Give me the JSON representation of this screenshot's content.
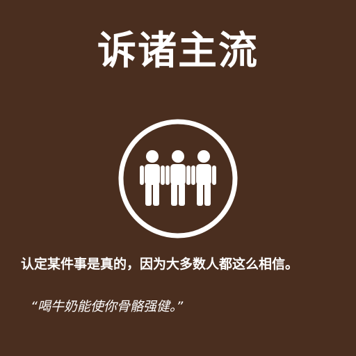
{
  "card": {
    "title": "诉诸主流",
    "icon": "crowd-of-people-icon",
    "description": "认定某件事是真的，因为大多数人都这么相信。",
    "example": "“喝牛奶能使你骨骼强健。”",
    "colors": {
      "background": "#4a2e1f",
      "foreground": "#ffffff"
    }
  }
}
